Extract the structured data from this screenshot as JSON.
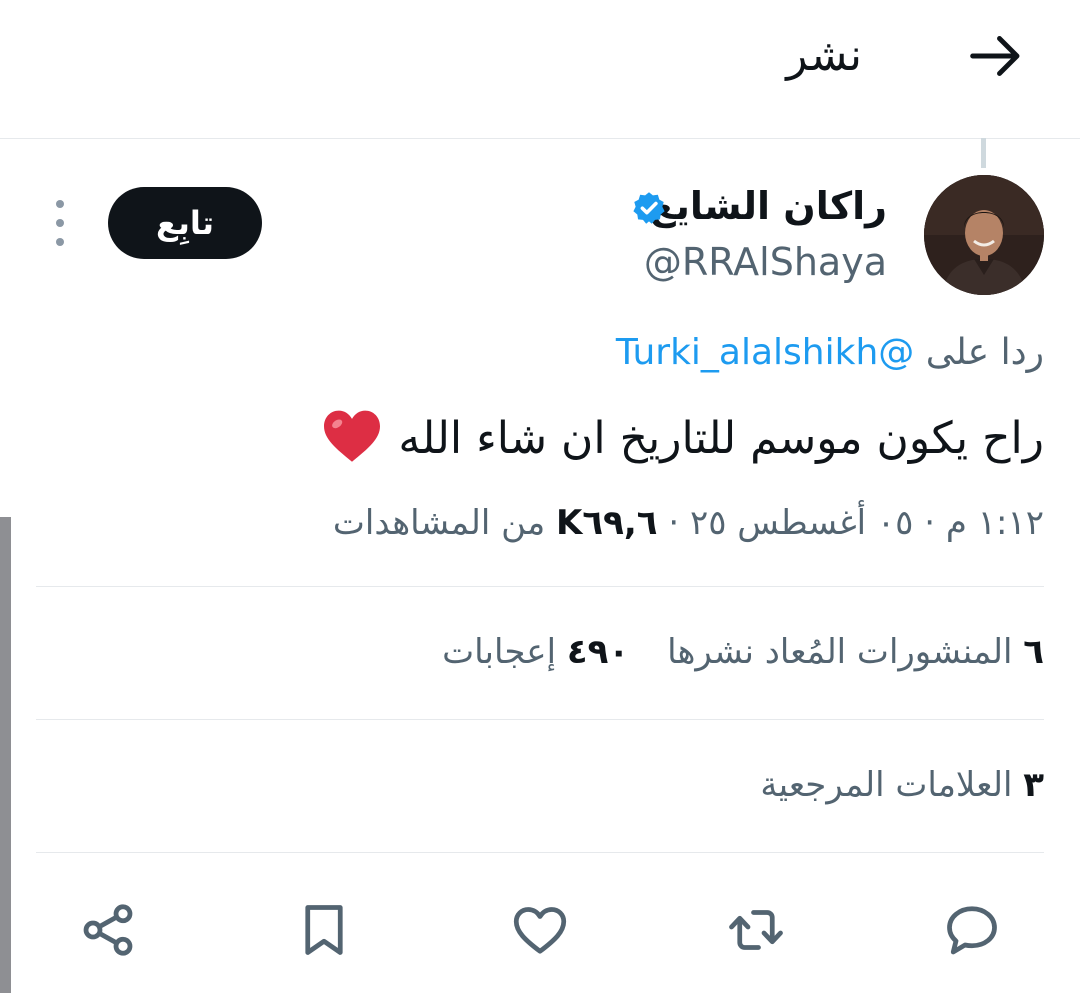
{
  "header": {
    "title": "نشر",
    "back_icon": "arrow-right-icon"
  },
  "author": {
    "name": "راكان الشايع",
    "handle": "@RRAlShaya",
    "verified_icon": "verified-badge-icon",
    "verified_color": "#1d9bf0"
  },
  "follow_button": {
    "label": "تابِع"
  },
  "more_icon": "more-vertical-icon",
  "reply": {
    "prefix": "ردا على",
    "mention": "@Turki_alalshikh"
  },
  "tweet": {
    "text": "راح يكون موسم للتاريخ ان شاء الله",
    "emoji": "red-heart-emoji"
  },
  "meta": {
    "time": "١:١٢ م",
    "sep1": "·",
    "date": "٠٥ أغسطس ٢٥",
    "sep2": "·",
    "views_count": "K٦٩,٦",
    "views_label": "من المشاهدات"
  },
  "stats": {
    "reposts_count": "٦",
    "reposts_label": "المنشورات المُعاد نشرها",
    "likes_count": "٤٩٠",
    "likes_label": "إعجابات",
    "bookmarks_count": "٣",
    "bookmarks_label": "العلامات المرجعية"
  },
  "actions": [
    "reply-icon",
    "repost-icon",
    "like-icon",
    "bookmark-icon",
    "share-icon"
  ],
  "colors": {
    "accent": "#1d9bf0",
    "text": "#0f1419",
    "secondary": "#536471",
    "divider": "#e6e9ec"
  }
}
